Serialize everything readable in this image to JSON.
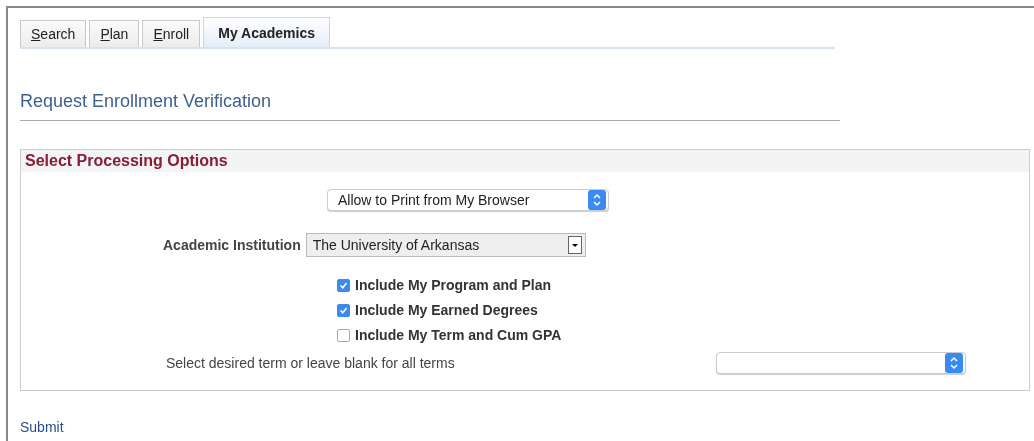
{
  "tabs": [
    {
      "label": "Search",
      "selected": false
    },
    {
      "label": "Plan",
      "selected": false
    },
    {
      "label": "Enroll",
      "selected": false
    },
    {
      "label": "My Academics",
      "selected": true
    }
  ],
  "page_title": "Request Enrollment Verification",
  "section": {
    "title": "Select Processing Options",
    "print_option": {
      "value": "Allow to Print from My Browser"
    },
    "institution": {
      "label": "Academic Institution",
      "value": "The University of Arkansas"
    },
    "options": [
      {
        "label": "Include My Program and Plan",
        "checked": true
      },
      {
        "label": "Include My Earned Degrees",
        "checked": true
      },
      {
        "label": "Include My Term and Cum GPA",
        "checked": false
      }
    ],
    "term": {
      "label": "Select desired term or leave blank for all terms"
    }
  },
  "submit": "Submit"
}
